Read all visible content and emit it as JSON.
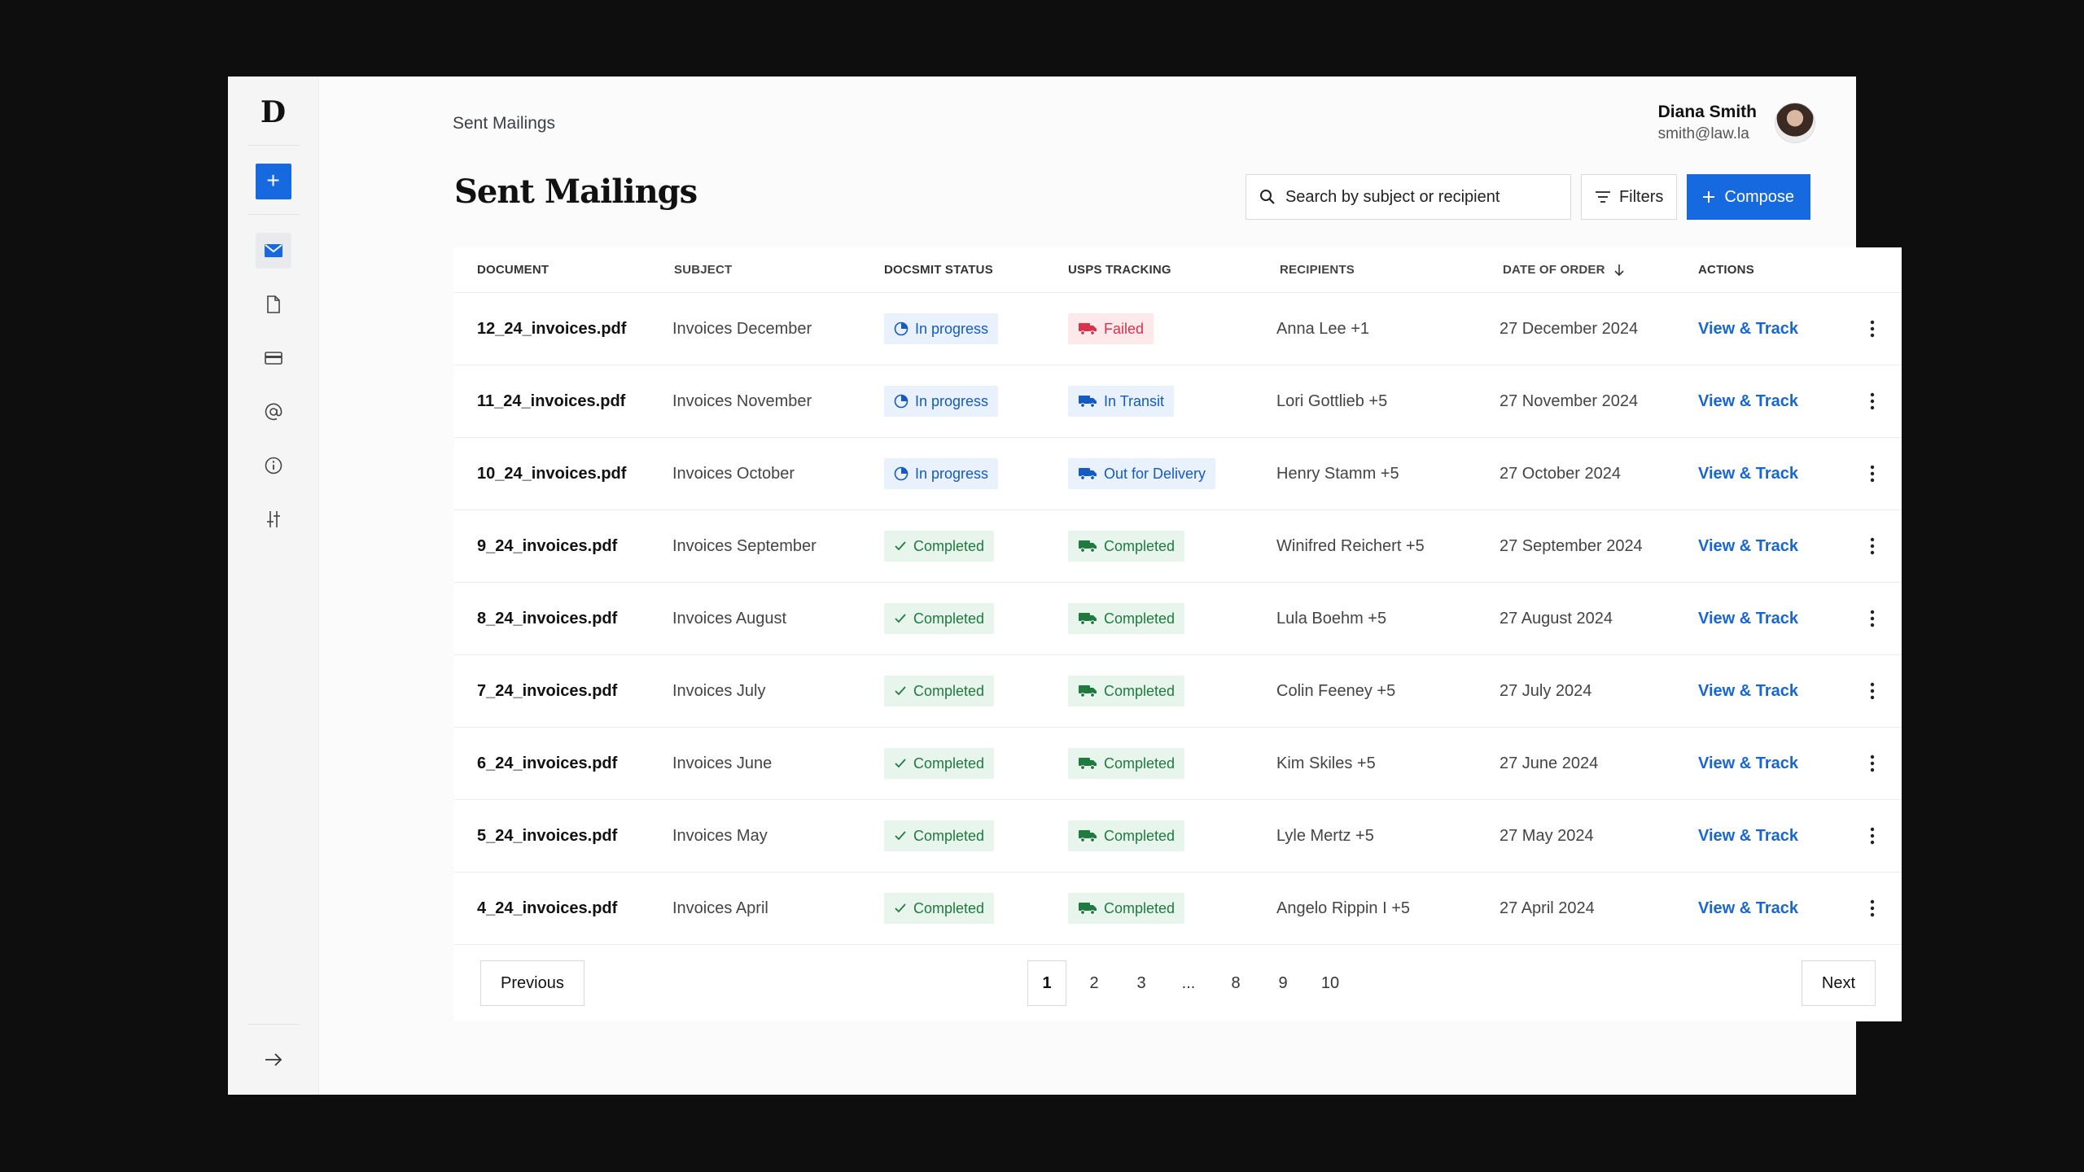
{
  "app": {
    "logo": "D"
  },
  "header": {
    "breadcrumb": "Sent Mailings",
    "title": "Sent Mailings"
  },
  "user": {
    "name": "Diana Smith",
    "email": "smith@law.la"
  },
  "toolbar": {
    "search_placeholder": "Search by subject or recipient",
    "filters_label": "Filters",
    "compose_label": "Compose"
  },
  "sidebar": {
    "nav": [
      "mail-icon",
      "document-icon",
      "card-icon",
      "at-icon",
      "info-icon",
      "sliders-icon"
    ]
  },
  "table": {
    "headers": {
      "document": "DOCUMENT",
      "subject": "SUBJECT",
      "status": "DOCSMIT STATUS",
      "tracking": "USPS TRACKING",
      "recipients": "RECIPIENTS",
      "date": "DATE OF ORDER",
      "actions": "ACTIONS"
    },
    "rows": [
      {
        "document": "12_24_invoices.pdf",
        "subject": "Invoices December",
        "status": "In progress",
        "status_type": "progress",
        "tracking": "Failed",
        "tracking_type": "failed",
        "recipients": "Anna Lee +1",
        "date": "27 December 2024",
        "action": "View & Track"
      },
      {
        "document": "11_24_invoices.pdf",
        "subject": "Invoices November",
        "status": "In progress",
        "status_type": "progress",
        "tracking": "In Transit",
        "tracking_type": "transit",
        "recipients": "Lori Gottlieb +5",
        "date": "27 November 2024",
        "action": "View & Track"
      },
      {
        "document": "10_24_invoices.pdf",
        "subject": "Invoices October",
        "status": "In progress",
        "status_type": "progress",
        "tracking": "Out for Delivery",
        "tracking_type": "transit",
        "recipients": "Henry Stamm +5",
        "date": "27 October 2024",
        "action": "View & Track"
      },
      {
        "document": "9_24_invoices.pdf",
        "subject": "Invoices September",
        "status": "Completed",
        "status_type": "done",
        "tracking": "Completed",
        "tracking_type": "done",
        "recipients": "Winifred Reichert +5",
        "date": "27 September 2024",
        "action": "View & Track"
      },
      {
        "document": "8_24_invoices.pdf",
        "subject": "Invoices August",
        "status": "Completed",
        "status_type": "done",
        "tracking": "Completed",
        "tracking_type": "done",
        "recipients": "Lula Boehm +5",
        "date": "27 August 2024",
        "action": "View & Track"
      },
      {
        "document": "7_24_invoices.pdf",
        "subject": "Invoices July",
        "status": "Completed",
        "status_type": "done",
        "tracking": "Completed",
        "tracking_type": "done",
        "recipients": "Colin Feeney +5",
        "date": "27 July 2024",
        "action": "View & Track"
      },
      {
        "document": "6_24_invoices.pdf",
        "subject": "Invoices June",
        "status": "Completed",
        "status_type": "done",
        "tracking": "Completed",
        "tracking_type": "done",
        "recipients": "Kim Skiles +5",
        "date": "27 June 2024",
        "action": "View & Track"
      },
      {
        "document": "5_24_invoices.pdf",
        "subject": "Invoices May",
        "status": "Completed",
        "status_type": "done",
        "tracking": "Completed",
        "tracking_type": "done",
        "recipients": "Lyle Mertz +5",
        "date": "27 May 2024",
        "action": "View & Track"
      },
      {
        "document": "4_24_invoices.pdf",
        "subject": "Invoices April",
        "status": "Completed",
        "status_type": "done",
        "tracking": "Completed",
        "tracking_type": "done",
        "recipients": "Angelo Rippin I +5",
        "date": "27 April 2024",
        "action": "View & Track"
      }
    ]
  },
  "pagination": {
    "previous": "Previous",
    "next": "Next",
    "pages": [
      "1",
      "2",
      "3",
      "...",
      "8",
      "9",
      "10"
    ],
    "current": "1"
  },
  "colors": {
    "accent": "#1769e0",
    "failed": "#d8334a",
    "success": "#1f7a3f"
  }
}
